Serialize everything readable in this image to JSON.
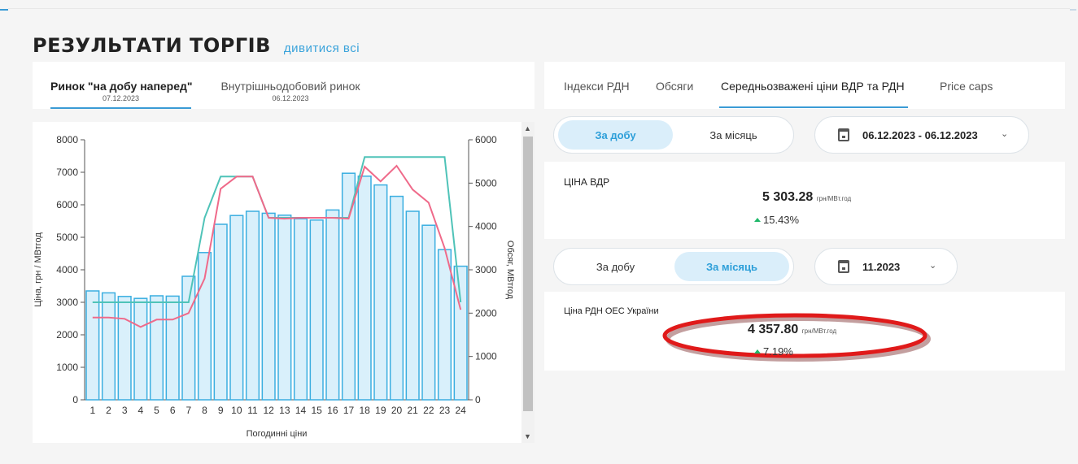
{
  "header": {
    "title": "РЕЗУЛЬТАТИ ТОРГІВ",
    "view_all": "дивитися всі"
  },
  "left_tabs": [
    {
      "label": "Ринок \"на добу наперед\"",
      "date": "07.12.2023",
      "active": true
    },
    {
      "label": "Внутрішньодобовий ринок",
      "date": "06.12.2023",
      "active": false
    }
  ],
  "right_tabs": [
    {
      "label": "Індекси РДН",
      "active": false
    },
    {
      "label": "Обсяги",
      "active": false
    },
    {
      "label": "Середньозважені ціни ВДР та РДН",
      "active": true
    },
    {
      "label": "Price caps",
      "active": false
    }
  ],
  "block1": {
    "period_options": [
      "За добу",
      "За місяць"
    ],
    "active_period": "За добу",
    "date_range": "06.12.2023 - 06.12.2023",
    "title": "ЦІНА ВДР",
    "value": "5 303.28",
    "unit": "грн/МВт.год",
    "change": "15.43%"
  },
  "block2": {
    "period_options": [
      "За добу",
      "За місяць"
    ],
    "active_period": "За місяць",
    "date_range": "11.2023",
    "title": "Ціна РДН ОЕС України",
    "value": "4 357.80",
    "unit": "грн/МВт.год",
    "change": "7.19%"
  },
  "colors": {
    "accent": "#3a9bd5",
    "bar": "#3aaee0",
    "bar_fill": "#d9f0fb",
    "line_teal": "#4fc3b8",
    "line_pink": "#ef6a8a",
    "highlight": "#e01a1a",
    "up": "#1fb86a"
  },
  "chart_data": {
    "type": "bar",
    "title": "",
    "xlabel": "Погодинні ціни",
    "ylabel": "Ціна, грн / МВтгод",
    "y2label": "Обсяг, МВтгод",
    "ylim": [
      0,
      8000
    ],
    "y2lim": [
      0,
      6000
    ],
    "yticks": [
      0,
      1000,
      2000,
      3000,
      4000,
      5000,
      6000,
      7000,
      8000
    ],
    "y2ticks": [
      0,
      1000,
      2000,
      3000,
      4000,
      5000,
      6000
    ],
    "categories": [
      "1",
      "2",
      "3",
      "4",
      "5",
      "6",
      "7",
      "8",
      "9",
      "10",
      "11",
      "12",
      "13",
      "14",
      "15",
      "16",
      "17",
      "18",
      "19",
      "20",
      "21",
      "22",
      "23",
      "24"
    ],
    "series": [
      {
        "kind": "bar",
        "axis": "y",
        "values": [
          3350,
          3290,
          3180,
          3120,
          3200,
          3190,
          3800,
          4530,
          5400,
          5670,
          5800,
          5740,
          5680,
          5570,
          5530,
          5840,
          6970,
          6880,
          6610,
          6260,
          5800,
          5370,
          4620,
          4110
        ]
      },
      {
        "kind": "line",
        "axis": "y2",
        "color": "teal",
        "values": [
          2250,
          2250,
          2250,
          2250,
          2250,
          2250,
          2250,
          4200,
          5150,
          5150,
          5150,
          4200,
          4200,
          4200,
          4200,
          4200,
          4200,
          5600,
          5600,
          5600,
          5600,
          5600,
          5600,
          2250
        ]
      },
      {
        "kind": "line",
        "axis": "y2",
        "color": "pink",
        "values": [
          1900,
          1900,
          1870,
          1680,
          1850,
          1850,
          2000,
          2800,
          4870,
          5150,
          5150,
          4200,
          4180,
          4200,
          4200,
          4200,
          4180,
          5380,
          5040,
          5400,
          4850,
          4550,
          3500,
          2080
        ]
      }
    ],
    "grid": false,
    "legend": "none"
  }
}
